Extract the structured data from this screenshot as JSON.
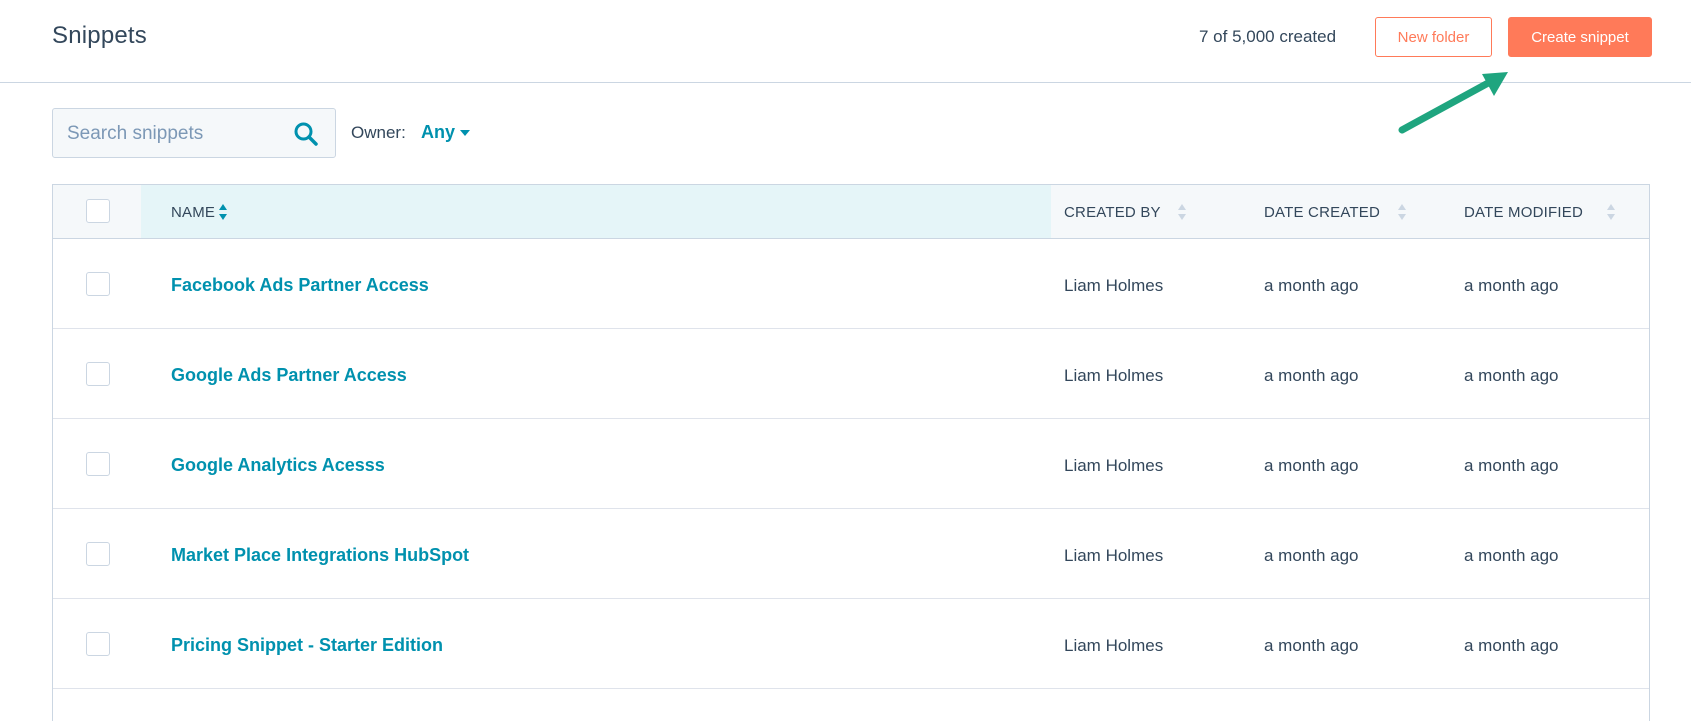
{
  "header": {
    "title": "Snippets",
    "count_text": "7 of 5,000 created",
    "new_folder_label": "New folder",
    "create_snippet_label": "Create snippet"
  },
  "toolbar": {
    "search_placeholder": "Search snippets",
    "owner_label": "Owner:",
    "owner_value": "Any"
  },
  "table": {
    "columns": [
      "NAME",
      "CREATED BY",
      "DATE CREATED",
      "DATE MODIFIED"
    ],
    "rows": [
      {
        "name": "Facebook Ads Partner Access",
        "created_by": "Liam Holmes",
        "date_created": "a month ago",
        "date_modified": "a month ago"
      },
      {
        "name": "Google Ads Partner Access",
        "created_by": "Liam Holmes",
        "date_created": "a month ago",
        "date_modified": "a month ago"
      },
      {
        "name": "Google Analytics Acesss",
        "created_by": "Liam Holmes",
        "date_created": "a month ago",
        "date_modified": "a month ago"
      },
      {
        "name": "Market Place Integrations HubSpot",
        "created_by": "Liam Holmes",
        "date_created": "a month ago",
        "date_modified": "a month ago"
      },
      {
        "name": "Pricing Snippet - Starter Edition",
        "created_by": "Liam Holmes",
        "date_created": "a month ago",
        "date_modified": "a month ago"
      }
    ]
  },
  "colors": {
    "accent": "#ff7a59",
    "link": "#0091ae",
    "text": "#33475b",
    "annotation_arrow": "#1fa57f"
  }
}
